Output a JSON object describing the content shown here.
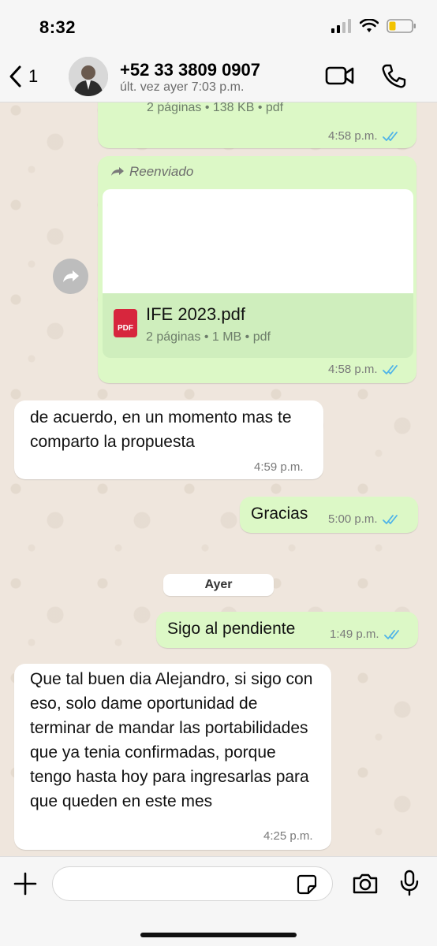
{
  "status_bar": {
    "time": "8:32"
  },
  "header": {
    "back_count": "1",
    "contact_name": "+52 33 3809 0907",
    "contact_status": "últ. vez ayer 7:03 p.m."
  },
  "messages": {
    "first_file": {
      "info": "2 páginas • 138 KB • pdf",
      "time": "4:58 p.m."
    },
    "forwarded_file": {
      "forward_label": "Reenviado",
      "icon_text": "PDF",
      "file_name": "IFE 2023.pdf",
      "file_info": "2 páginas • 1 MB • pdf",
      "time": "4:58 p.m."
    },
    "msg_1": {
      "text": "de acuerdo, en un momento mas te comparto la propuesta",
      "time": "4:59 p.m."
    },
    "msg_2": {
      "text": "Gracias",
      "time": "5:00 p.m."
    },
    "date_separator": "Ayer",
    "msg_3": {
      "text": "Sigo al pendiente",
      "time": "1:49 p.m."
    },
    "msg_4": {
      "text": "Que tal buen dia Alejandro, si sigo con eso, solo dame oportunidad de terminar de mandar las portabilidades que ya tenia confirmadas, porque tengo hasta hoy para ingresarlas para que queden en este mes",
      "time": "4:25 p.m."
    }
  },
  "input": {
    "placeholder": ""
  },
  "colors": {
    "outgoing_bubble": "#dcf8c6",
    "incoming_bubble": "#ffffff",
    "read_ticks": "#4fb3e8",
    "pdf_icon": "#d7263d"
  },
  "icons": [
    "chevron-left-icon",
    "video-camera-icon",
    "phone-icon",
    "forward-arrow-icon",
    "plus-icon",
    "sticker-icon",
    "camera-icon",
    "microphone-icon",
    "double-check-icon"
  ]
}
